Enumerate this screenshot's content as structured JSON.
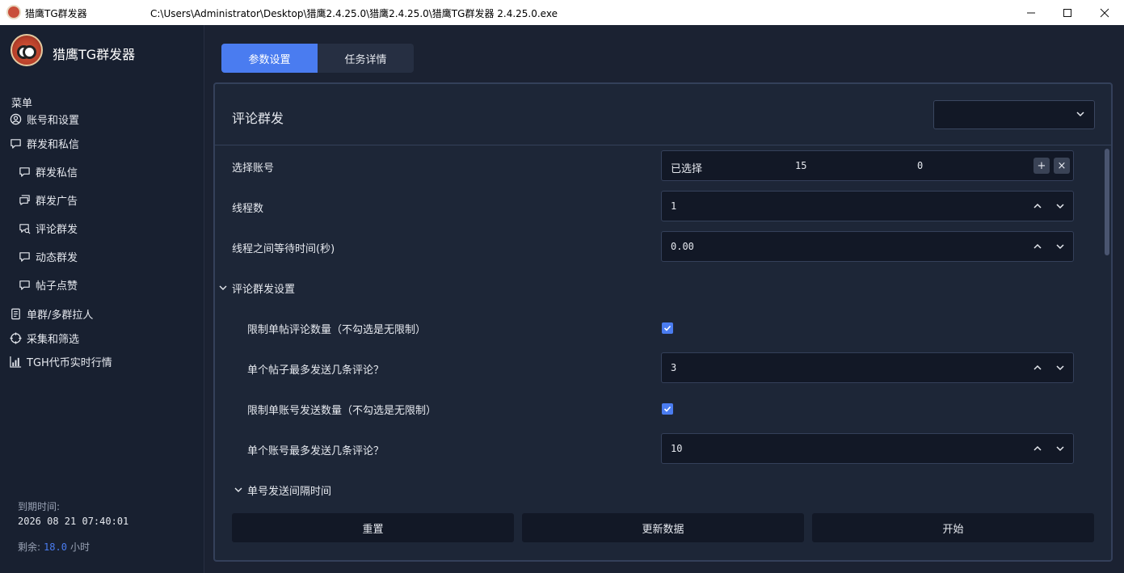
{
  "window": {
    "app_name": "猎鹰TG群发器",
    "path": "C:\\Users\\Administrator\\Desktop\\猎鹰2.4.25.0\\猎鹰2.4.25.0\\猎鹰TG群发器 2.4.25.0.exe",
    "minimize": "—",
    "maximize": "☐",
    "close": "✕"
  },
  "sidebar": {
    "title": "猎鹰TG群发器",
    "menu_heading": "菜单",
    "items": [
      {
        "label": "账号和设置",
        "icon": "user-circle-icon"
      },
      {
        "label": "群发和私信",
        "icon": "chat-bubble-icon"
      },
      {
        "label": "群发私信",
        "icon": "chat-bubble-icon"
      },
      {
        "label": "群发广告",
        "icon": "chat-double-icon"
      },
      {
        "label": "评论群发",
        "icon": "chat-search-icon"
      },
      {
        "label": "动态群发",
        "icon": "chat-bubble-icon"
      },
      {
        "label": "帖子点赞",
        "icon": "chat-bubble-icon"
      },
      {
        "label": "单群/多群拉人",
        "icon": "document-icon"
      },
      {
        "label": "采集和筛选",
        "icon": "crosshair-icon"
      },
      {
        "label": "TGH代币实时行情",
        "icon": "bar-chart-icon"
      }
    ],
    "expiry_label": "到期时间:",
    "expiry_value": "2026 08 21 07:40:01",
    "remain_label": "剩余:",
    "remain_value": "18.0",
    "remain_unit": "小时"
  },
  "tabs": [
    {
      "label": "参数设置",
      "active": true
    },
    {
      "label": "任务详情",
      "active": false
    }
  ],
  "panel": {
    "title": "评论群发",
    "select_value": "",
    "account": {
      "label": "选择账号",
      "status": "已选择",
      "count_a": "15",
      "count_b": "0",
      "add": "+",
      "clear": "×"
    },
    "threads": {
      "label": "线程数",
      "value": "1"
    },
    "wait": {
      "label": "线程之间等待时间(秒)",
      "value": "0.00"
    },
    "section": {
      "label": "评论群发设置"
    },
    "limit_post": {
      "label": "限制单帖评论数量（不勾选是无限制）",
      "checked": true
    },
    "max_per_post": {
      "label": "单个帖子最多发送几条评论？",
      "value": "3"
    },
    "limit_account": {
      "label": "限制单账号发送数量（不勾选是无限制）",
      "checked": true
    },
    "max_per_account": {
      "label": "单个账号最多发送几条评论？",
      "value": "10"
    },
    "interval": {
      "label": "单号发送间隔时间"
    },
    "buttons": {
      "reset": "重置",
      "refresh": "更新数据",
      "start": "开始"
    }
  },
  "colors": {
    "accent": "#4a7cf0",
    "bg": "#1b2232",
    "sidebar": "#182030",
    "field": "#121826"
  }
}
